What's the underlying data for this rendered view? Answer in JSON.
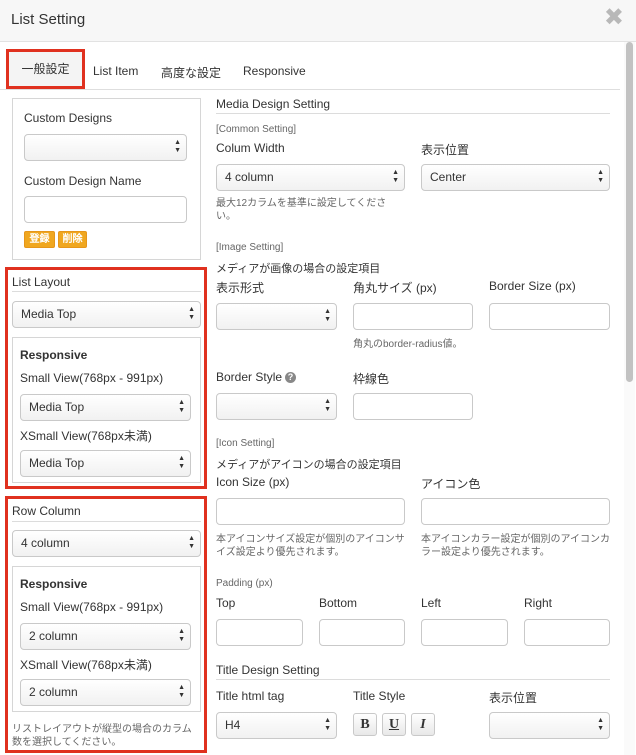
{
  "window": {
    "title": "List Setting",
    "close_glyph": "✖"
  },
  "tabs": [
    "一般設定",
    "List Item",
    "高度な設定",
    "Responsive"
  ],
  "custom_designs": {
    "label": "Custom Designs",
    "select_value": "",
    "name_label": "Custom Design Name",
    "name_value": "",
    "register": "登録",
    "delete": "削除"
  },
  "list_layout": {
    "label": "List Layout",
    "value": "Media Top",
    "responsive_title": "Responsive",
    "small_label": "Small View(768px - 991px)",
    "small_value": "Media Top",
    "xsmall_label": "XSmall View(768px未満)",
    "xsmall_value": "Media Top"
  },
  "row_column": {
    "label": "Row Column",
    "value": "4 column",
    "responsive_title": "Responsive",
    "small_label": "Small View(768px - 991px)",
    "small_value": "2 column",
    "xsmall_label": "XSmall View(768px未満)",
    "xsmall_value": "2 column",
    "note": "リストレイアウトが縦型の場合のカラム数を選択してください。"
  },
  "media": {
    "section_title": "Media Design Setting",
    "common_heading": "[Common Setting]",
    "colum_width_label": "Colum Width",
    "colum_width_value": "4 column",
    "colum_width_note": "最大12カラムを基準に設定してください。",
    "position_label": "表示位置",
    "position_value": "Center",
    "image_heading": "[Image Setting]",
    "image_desc": "メディアが画像の場合の設定項目",
    "display_format_label": "表示形式",
    "display_format_value": "",
    "radius_label": "角丸サイズ (px)",
    "radius_value": "",
    "radius_note": "角丸のborder-radius値。",
    "border_size_label": "Border Size (px)",
    "border_size_value": "",
    "border_style_label": "Border Style",
    "border_style_value": "",
    "border_color_label": "枠線色",
    "border_color_value": "",
    "icon_heading": "[Icon Setting]",
    "icon_desc": "メディアがアイコンの場合の設定項目",
    "icon_size_label": "Icon Size (px)",
    "icon_size_value": "",
    "icon_size_note": "本アイコンサイズ設定が個別のアイコンサイズ設定より優先されます。",
    "icon_color_label": "アイコン色",
    "icon_color_value": "",
    "icon_color_note": "本アイコンカラー設定が個別のアイコンカラー設定より優先されます。",
    "padding_heading": "Padding (px)",
    "top_label": "Top",
    "bottom_label": "Bottom",
    "left_label": "Left",
    "right_label": "Right"
  },
  "title_design": {
    "section_title": "Title Design Setting",
    "tag_label": "Title html tag",
    "tag_value": "H4",
    "style_label": "Title Style",
    "bold": "B",
    "underline": "U",
    "italic": "I",
    "position_label": "表示位置",
    "position_value": ""
  },
  "colors": {
    "highlight": "#e0311f",
    "button": "#f0a71f"
  }
}
